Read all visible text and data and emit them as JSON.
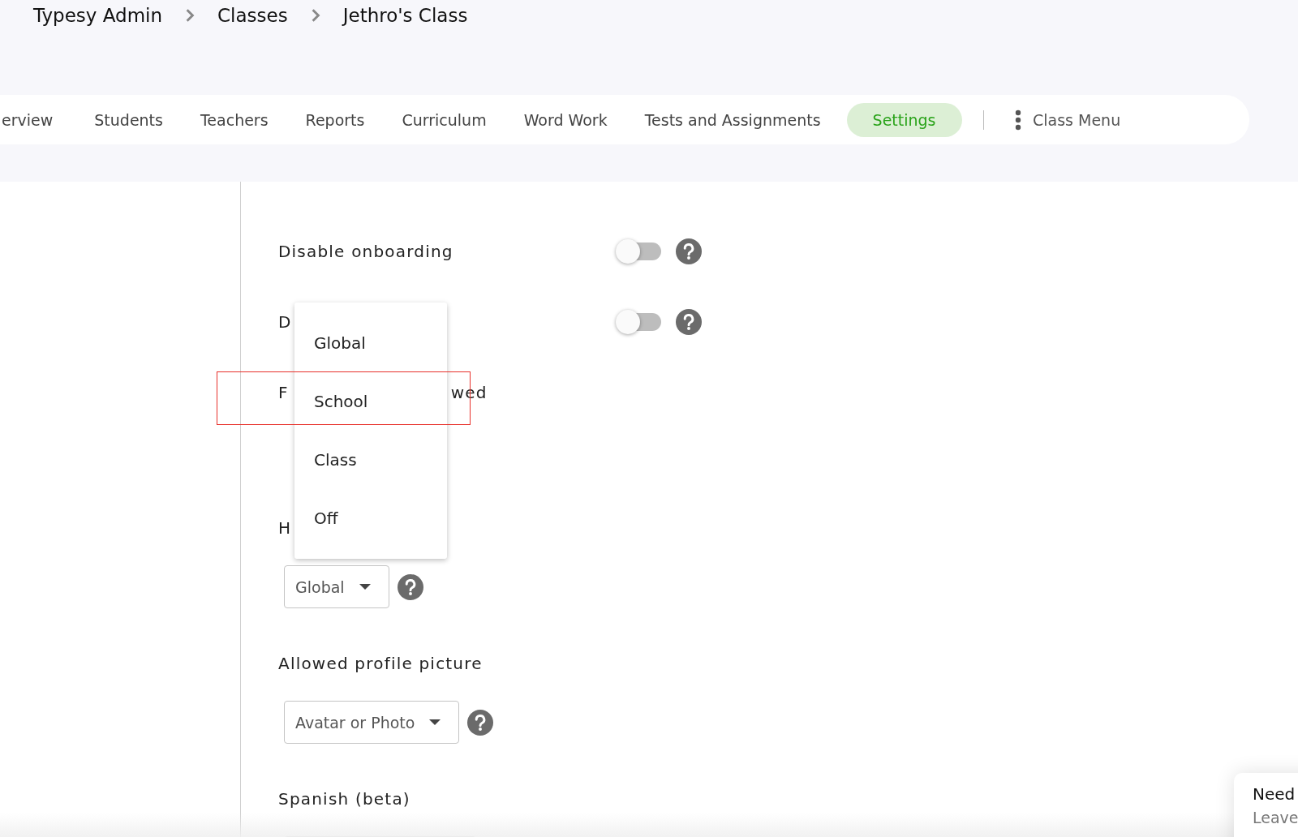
{
  "breadcrumb": [
    "Typesy Admin",
    "Classes",
    "Jethro's Class"
  ],
  "tabs": [
    {
      "label": "erview",
      "selected": false
    },
    {
      "label": "Students",
      "selected": false
    },
    {
      "label": "Teachers",
      "selected": false
    },
    {
      "label": "Reports",
      "selected": false
    },
    {
      "label": "Curriculum",
      "selected": false
    },
    {
      "label": "Word Work",
      "selected": false
    },
    {
      "label": "Tests and Assignments",
      "selected": false
    },
    {
      "label": "Settings",
      "selected": true
    }
  ],
  "class_menu": "Class Menu",
  "settings": [
    {
      "kind": "toggle",
      "label": "Disable onboarding",
      "on": false
    },
    {
      "kind": "toggle",
      "label": "D",
      "on": false
    },
    {
      "kind": "select",
      "label_parts": [
        "F",
        "wed"
      ]
    },
    {
      "kind": "select",
      "label": "H",
      "value": "Global"
    },
    {
      "kind": "select",
      "label": "Allowed profile picture",
      "value": "Avatar or Photo"
    },
    {
      "kind": "select",
      "label": "Spanish (beta)"
    }
  ],
  "dropdown_menu": [
    "Global",
    "School",
    "Class",
    "Off"
  ],
  "help_widget": {
    "title": "Need",
    "subtitle": "Leave"
  }
}
